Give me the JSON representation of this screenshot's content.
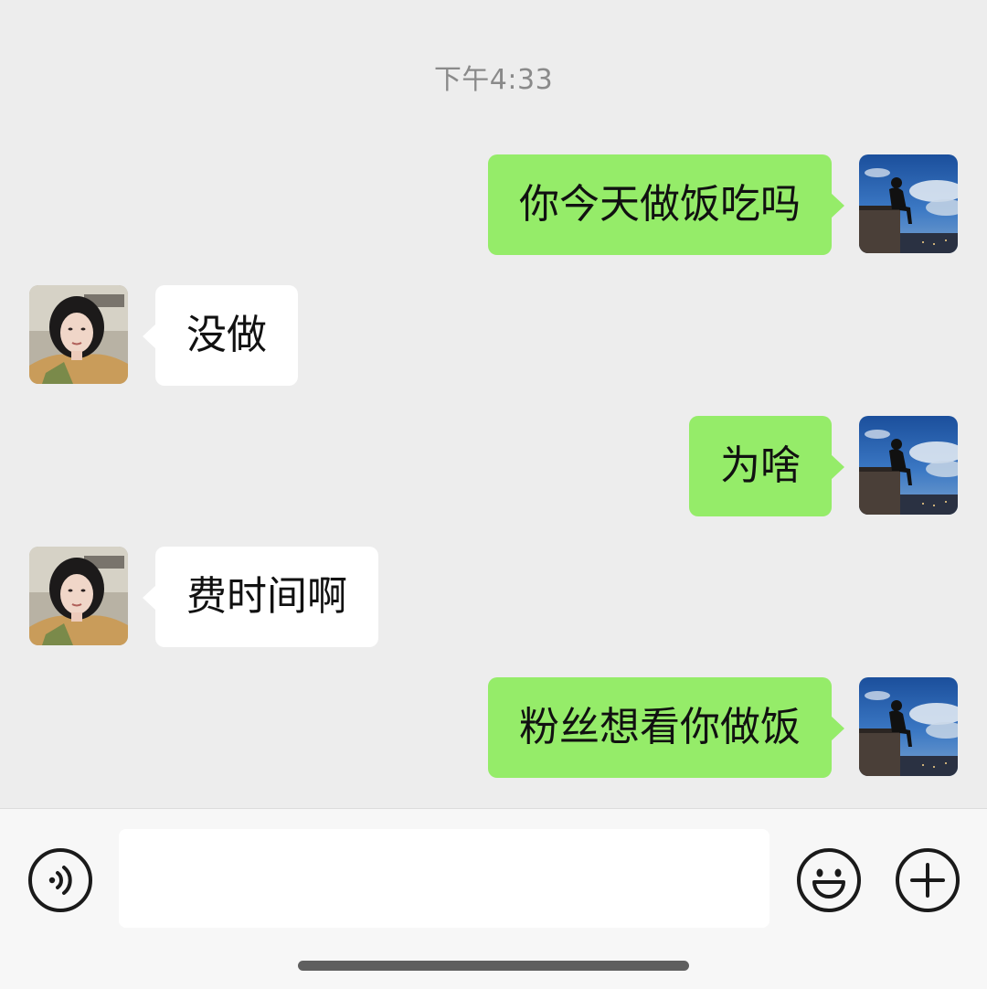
{
  "chat": {
    "timestamp": "下午4:33",
    "messages": [
      {
        "side": "right",
        "text": "你今天做饭吃吗",
        "avatar": "user-avatar"
      },
      {
        "side": "left",
        "text": "没做",
        "avatar": "contact-avatar"
      },
      {
        "side": "right",
        "text": "为啥",
        "avatar": "user-avatar"
      },
      {
        "side": "left",
        "text": "费时间啊",
        "avatar": "contact-avatar"
      },
      {
        "side": "right",
        "text": "粉丝想看你做饭",
        "avatar": "user-avatar"
      }
    ]
  },
  "input_bar": {
    "value": "",
    "placeholder": "",
    "icons": {
      "voice": "voice-icon",
      "emoji": "emoji-icon",
      "plus": "plus-icon"
    }
  },
  "colors": {
    "background": "#ededed",
    "sent_bubble": "#95ec69",
    "received_bubble": "#ffffff",
    "input_bar": "#f7f7f7"
  }
}
